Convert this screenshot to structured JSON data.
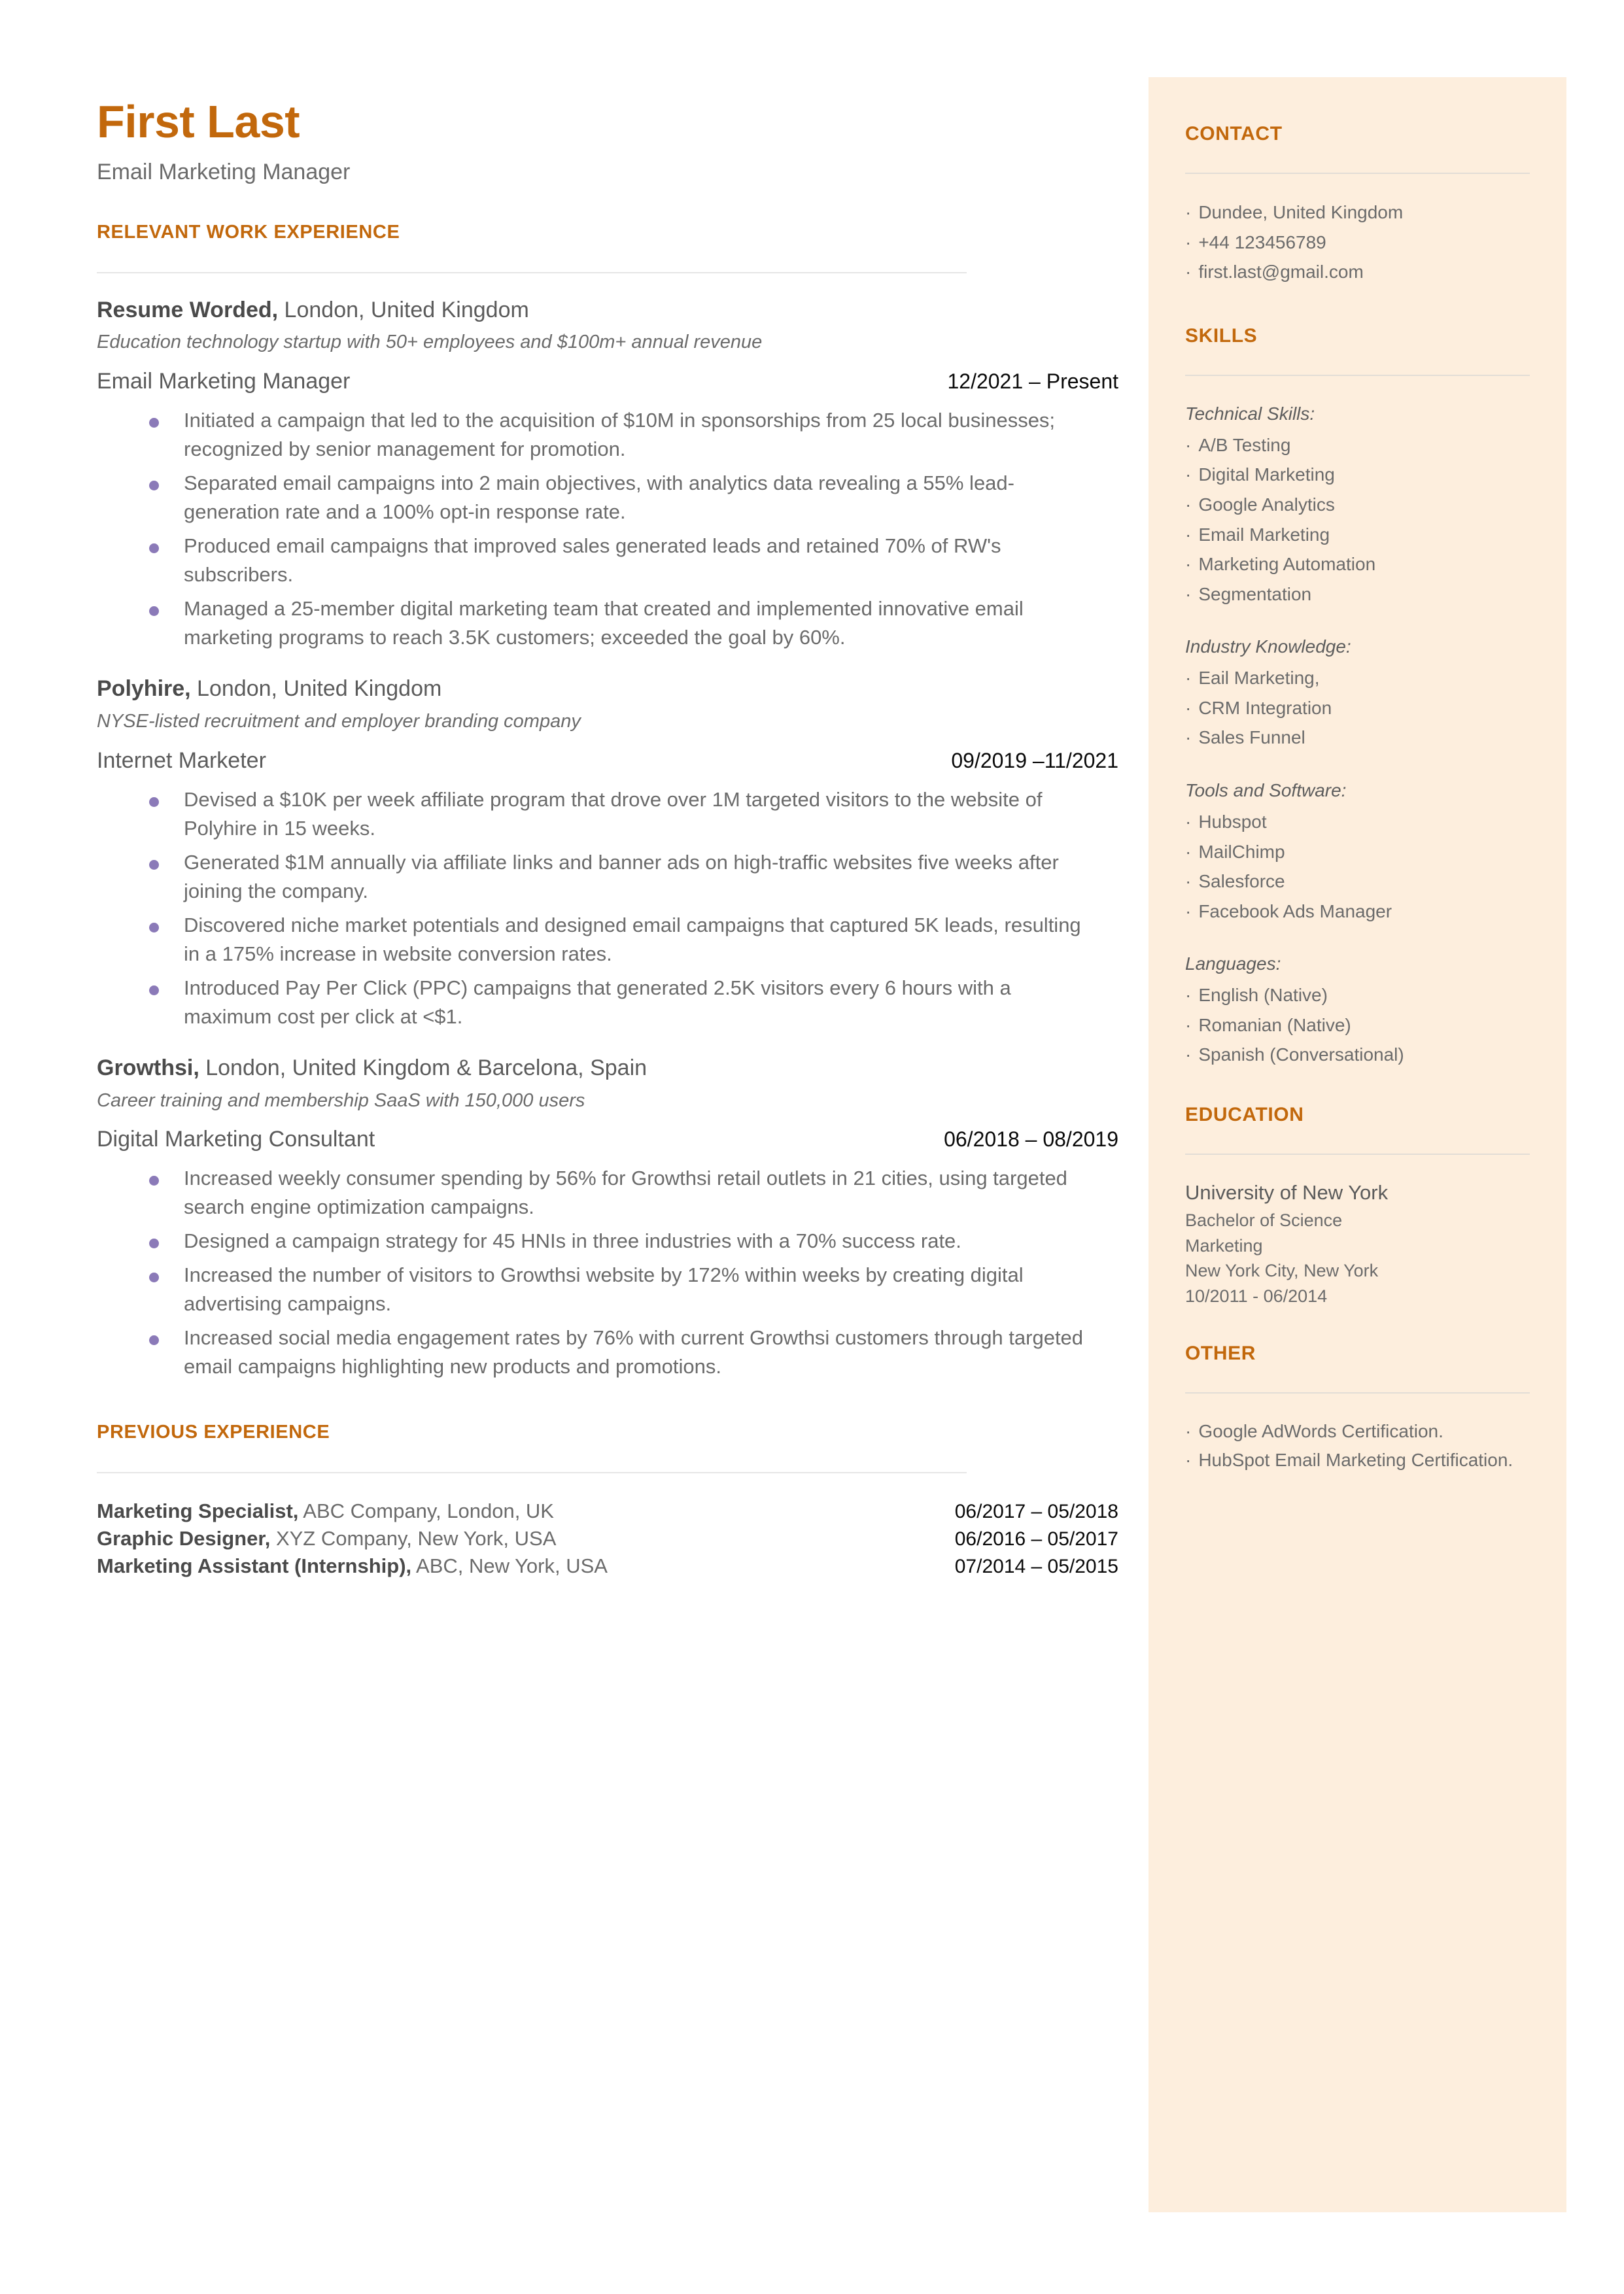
{
  "colors": {
    "accent": "#c2680c",
    "sidebar_bg": "#fdeedd",
    "body_text": "#6b6b6b",
    "bullet": "#8b7ab8",
    "date_text": "#0a0a0a",
    "rule": "#e6e6e6"
  },
  "header": {
    "name": "First Last",
    "title": "Email Marketing Manager"
  },
  "main": {
    "work_heading": "RELEVANT WORK EXPERIENCE",
    "previous_heading": "PREVIOUS EXPERIENCE",
    "jobs": [
      {
        "company": "Resume Worded,",
        "location": " London, United Kingdom",
        "description": "Education technology startup with 50+ employees and $100m+ annual revenue",
        "title": "Email Marketing Manager",
        "date": "12/2021 – Present",
        "bullets": [
          "Initiated a campaign that led to the acquisition of $10M in sponsorships from 25 local businesses; recognized by senior management for promotion.",
          "Separated email campaigns into 2 main objectives, with analytics data revealing a 55% lead-generation rate and a 100% opt-in response rate.",
          "Produced email campaigns that improved sales generated leads and retained 70% of RW's subscribers.",
          "Managed a 25-member digital marketing team that created and implemented innovative email marketing programs to reach 3.5K customers; exceeded the goal by 60%."
        ]
      },
      {
        "company": "Polyhire,",
        "location": " London, United Kingdom",
        "description": "NYSE-listed recruitment and employer branding company",
        "title": "Internet Marketer",
        "date": "09/2019 –11/2021",
        "bullets": [
          "Devised a $10K per week affiliate program that drove over 1M targeted visitors to the website of Polyhire in 15 weeks.",
          "Generated $1M annually via affiliate links and banner ads on high-traffic websites five weeks after joining the company.",
          "Discovered niche market potentials and designed email campaigns that captured 5K leads, resulting in a 175% increase in website conversion rates.",
          "Introduced Pay Per Click (PPC) campaigns that generated 2.5K visitors every 6 hours with a maximum cost per click at <$1."
        ]
      },
      {
        "company": "Growthsi,",
        "location": " London, United Kingdom & Barcelona, Spain",
        "description": "Career training and membership SaaS with 150,000 users",
        "title": "Digital Marketing Consultant",
        "date": "06/2018 – 08/2019",
        "bullets": [
          "Increased weekly consumer spending by 56% for Growthsi retail outlets in 21 cities, using targeted search engine optimization campaigns.",
          "Designed a campaign strategy for 45 HNIs in three industries with a 70% success rate.",
          "Increased the number of visitors to Growthsi website by 172% within  weeks by creating digital advertising campaigns.",
          "Increased social media engagement rates by 76% with current Growthsi customers through targeted email campaigns highlighting new products and promotions."
        ]
      }
    ],
    "previous": [
      {
        "role": "Marketing Specialist,",
        "detail": " ABC Company, London, UK",
        "date": "06/2017 – 05/2018"
      },
      {
        "role": "Graphic Designer,",
        "detail": " XYZ Company, New York, USA",
        "date": "06/2016 – 05/2017"
      },
      {
        "role": "Marketing Assistant (Internship),",
        "detail": " ABC, New York, USA",
        "date": "07/2014 – 05/2015"
      }
    ]
  },
  "sidebar": {
    "contact": {
      "heading": "CONTACT",
      "items": [
        "Dundee, United Kingdom",
        "+44 123456789",
        "first.last@gmail.com"
      ]
    },
    "skills": {
      "heading": "SKILLS",
      "groups": [
        {
          "label": "Technical Skills:",
          "items": [
            "A/B Testing",
            "Digital Marketing",
            "Google Analytics",
            "Email Marketing",
            "Marketing Automation",
            "Segmentation"
          ]
        },
        {
          "label": "Industry Knowledge:",
          "items": [
            "Eail Marketing,",
            "CRM Integration",
            "Sales Funnel"
          ]
        },
        {
          "label": "Tools and Software:",
          "items": [
            "Hubspot",
            "MailChimp",
            "Salesforce",
            "Facebook Ads Manager"
          ]
        },
        {
          "label": "Languages:",
          "items": [
            "English (Native)",
            "Romanian (Native)",
            "Spanish (Conversational)"
          ]
        }
      ]
    },
    "education": {
      "heading": "EDUCATION",
      "school": "University of New York",
      "degree": "Bachelor of Science",
      "field": "Marketing",
      "location": "New York City, New York",
      "dates": "10/2011 - 06/2014"
    },
    "other": {
      "heading": "OTHER",
      "items": [
        "Google AdWords Certification.",
        "HubSpot Email Marketing Certification."
      ]
    }
  }
}
